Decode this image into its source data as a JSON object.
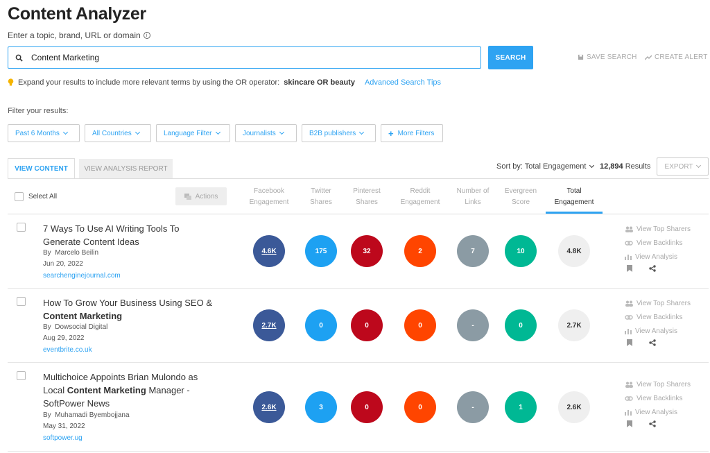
{
  "header": {
    "title": "Content Analyzer",
    "subtitle": "Enter a topic, brand, URL or domain",
    "info_icon": "ⓘ"
  },
  "search": {
    "value": "Content Marketing",
    "button_label": "SEARCH",
    "save_label": "SAVE SEARCH",
    "alert_label": "CREATE ALERT"
  },
  "tip": {
    "text": "Expand your results to include more relevant terms by using the OR operator:",
    "example": "skincare OR beauty",
    "link": "Advanced Search Tips"
  },
  "filters": {
    "label": "Filter your results:",
    "items": [
      "Past 6 Months",
      "All Countries",
      "Language Filter",
      "Journalists",
      "B2B publishers"
    ],
    "more": "More Filters"
  },
  "tabs": {
    "view_content": "VIEW CONTENT",
    "view_analysis": "VIEW ANALYSIS REPORT"
  },
  "toolbar": {
    "sort_label": "Sort by: Total Engagement",
    "results_count": "12,894",
    "results_label": "Results",
    "export_label": "EXPORT"
  },
  "table": {
    "select_all": "Select All",
    "actions": "Actions",
    "columns": [
      {
        "line1": "Facebook",
        "line2": "Engagement"
      },
      {
        "line1": "Twitter",
        "line2": "Shares"
      },
      {
        "line1": "Pinterest",
        "line2": "Shares"
      },
      {
        "line1": "Reddit",
        "line2": "Engagement"
      },
      {
        "line1": "Number of",
        "line2": "Links"
      },
      {
        "line1": "Evergreen",
        "line2": "Score"
      },
      {
        "line1": "Total",
        "line2": "Engagement"
      }
    ],
    "side_labels": {
      "sharers": "View Top Sharers",
      "backlinks": "View Backlinks",
      "analysis": "View Analysis"
    },
    "rows": [
      {
        "title_pre": "7 Ways To Use AI Writing Tools To Generate Content Ideas",
        "title_bold": "",
        "title_post": "",
        "author": "Marcelo Beilin",
        "date": "Jun 20, 2022",
        "domain": "searchenginejournal.com",
        "facebook": "4.6K",
        "twitter": "175",
        "pinterest": "32",
        "reddit": "2",
        "links": "7",
        "evergreen": "10",
        "total": "4.8K"
      },
      {
        "title_pre": "How To Grow Your Business Using SEO & ",
        "title_bold": "Content Marketing",
        "title_post": "",
        "author": "Dowsocial Digital",
        "date": "Aug 29, 2022",
        "domain": "eventbrite.co.uk",
        "facebook": "2.7K",
        "twitter": "0",
        "pinterest": "0",
        "reddit": "0",
        "links": "-",
        "evergreen": "0",
        "total": "2.7K"
      },
      {
        "title_pre": "Multichoice Appoints Brian Mulondo as Local ",
        "title_bold": "Content Marketing",
        "title_post": " Manager - SoftPower News",
        "author": "Muhamadi Byembojjana",
        "date": "May 31, 2022",
        "domain": "softpower.ug",
        "facebook": "2.6K",
        "twitter": "3",
        "pinterest": "0",
        "reddit": "0",
        "links": "-",
        "evergreen": "1",
        "total": "2.6K"
      }
    ]
  },
  "colors": {
    "accent": "#2ea3f2",
    "facebook": "#3b5998",
    "twitter": "#1da1f2",
    "pinterest": "#bd081c",
    "reddit": "#ff4500",
    "links": "#8b9ba4",
    "evergreen": "#00b894"
  }
}
